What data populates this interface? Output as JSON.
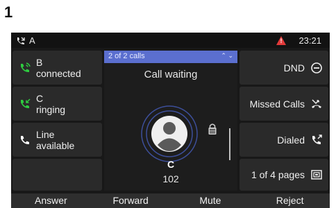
{
  "step_number": "1",
  "status_bar": {
    "account_label": "A",
    "alert_symbol": "!",
    "time": "23:21"
  },
  "line_keys_left": [
    {
      "line1": "B",
      "line2": "connected",
      "icon": "call-connected-icon",
      "color": "#2ecc40"
    },
    {
      "line1": "C",
      "line2": "ringing",
      "icon": "call-incoming-icon",
      "color": "#2ecc40"
    },
    {
      "line1": "Line",
      "line2": "available",
      "icon": "phone-icon",
      "color": "#ffffff"
    },
    {
      "line1": "",
      "line2": "",
      "icon": "",
      "color": ""
    }
  ],
  "line_keys_right": [
    {
      "label": "DND",
      "icon": "dnd-icon"
    },
    {
      "label": "Missed Calls",
      "icon": "missed-calls-icon"
    },
    {
      "label": "Dialed",
      "icon": "dialed-calls-icon"
    },
    {
      "label": "1 of 4 pages",
      "icon": "pages-icon"
    }
  ],
  "call_panel": {
    "call_count": "2 of 2 calls",
    "status": "Call waiting",
    "caller_name": "C",
    "caller_number": "102"
  },
  "softkeys": [
    "Answer",
    "Forward",
    "Mute",
    "Reject"
  ],
  "colors": {
    "accent": "#5b6fcf",
    "alert": "#e23a3a",
    "active_call": "#2ecc40"
  }
}
